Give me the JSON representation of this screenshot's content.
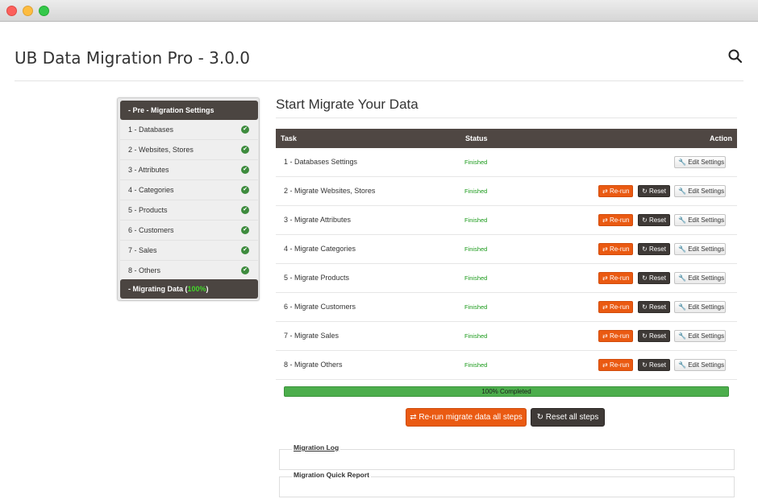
{
  "app": {
    "title": "UB Data Migration Pro - 3.0.0"
  },
  "sidebar": {
    "header": "- Pre - Migration Settings",
    "items": [
      {
        "label": "1 - Databases"
      },
      {
        "label": "2 - Websites, Stores"
      },
      {
        "label": "3 - Attributes"
      },
      {
        "label": "4 - Categories"
      },
      {
        "label": "5 - Products"
      },
      {
        "label": "6 - Customers"
      },
      {
        "label": "7 - Sales"
      },
      {
        "label": "8 - Others"
      }
    ],
    "footer_prefix": "- Migrating Data (",
    "footer_percent": "100%",
    "footer_suffix": ")"
  },
  "main": {
    "title": "Start Migrate Your Data",
    "columns": {
      "task": "Task",
      "status": "Status",
      "action": "Action"
    },
    "rows": [
      {
        "task": "1 - Databases Settings",
        "status": "Finished"
      },
      {
        "task": "2 - Migrate Websites, Stores",
        "status": "Finished"
      },
      {
        "task": "3 - Migrate Attributes",
        "status": "Finished"
      },
      {
        "task": "4 - Migrate Categories",
        "status": "Finished"
      },
      {
        "task": "5 - Migrate Products",
        "status": "Finished"
      },
      {
        "task": "6 - Migrate Customers",
        "status": "Finished"
      },
      {
        "task": "7 - Migrate Sales",
        "status": "Finished"
      },
      {
        "task": "8 - Migrate Others",
        "status": "Finished"
      }
    ],
    "buttons": {
      "rerun": "Re-run",
      "reset": "Reset",
      "edit": "Edit Settings"
    },
    "progress": {
      "value": 1.0,
      "label": "100% Completed"
    },
    "rerun_all": "Re-run migrate data all steps",
    "reset_all": "Reset all steps",
    "log_title": "Migration Log",
    "report_title": "Migration Quick Report"
  },
  "colors": {
    "accent": "#ea5a12",
    "dark": "#4f4743",
    "success": "#4cae4c",
    "percent": "#43d62a"
  },
  "icons": {
    "search": "search-icon",
    "check": "check-circle-icon",
    "rerun": "swap-arrows-icon",
    "reset": "refresh-icon",
    "edit": "wrench-icon"
  }
}
